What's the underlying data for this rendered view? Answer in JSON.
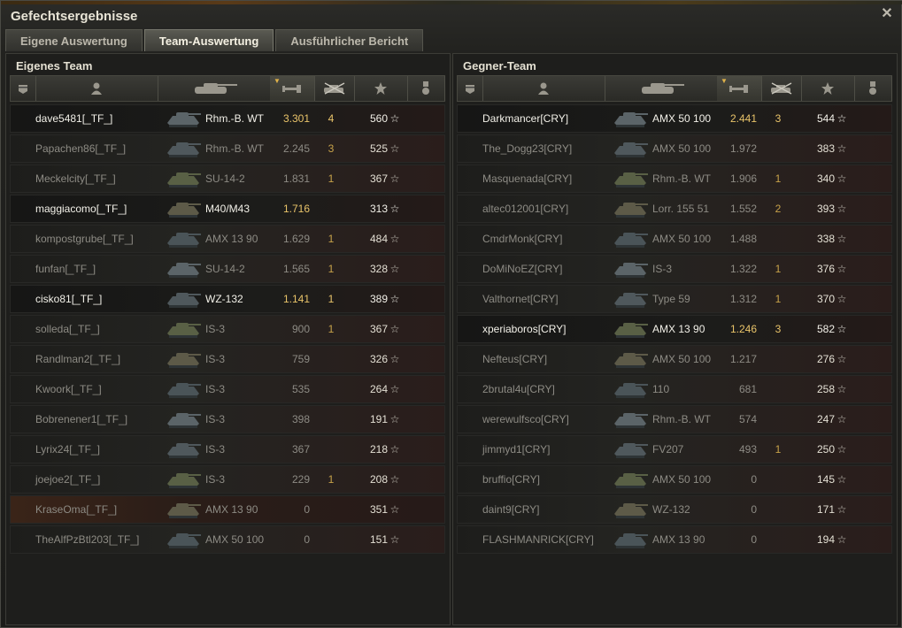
{
  "window": {
    "title": "Gefechtsergebnisse",
    "close_icon": "close-icon"
  },
  "tabs": [
    {
      "label": "Eigene Auswertung",
      "active": false
    },
    {
      "label": "Team-Auswertung",
      "active": true
    },
    {
      "label": "Ausführlicher Bericht",
      "active": false
    }
  ],
  "columns": [
    "platoon-icon",
    "player-icon",
    "tank-icon",
    "damage-icon",
    "kills-icon",
    "experience-star-icon",
    "medal-icon"
  ],
  "teams": {
    "own": {
      "title": "Eigenes Team",
      "rows": [
        {
          "name": "dave5481[_TF_]",
          "vehicle": "Rhm.-B. WT",
          "damage": "3.301",
          "kills": "4",
          "xp": "560",
          "alive": true
        },
        {
          "name": "Papachen86[_TF_]",
          "vehicle": "Rhm.-B. WT",
          "damage": "2.245",
          "kills": "3",
          "xp": "525",
          "alive": false
        },
        {
          "name": "Meckelcity[_TF_]",
          "vehicle": "SU-14-2",
          "damage": "1.831",
          "kills": "1",
          "xp": "367",
          "alive": false
        },
        {
          "name": "maggiacomo[_TF_]",
          "vehicle": "M40/M43",
          "damage": "1.716",
          "kills": "",
          "xp": "313",
          "alive": true
        },
        {
          "name": "kompostgrube[_TF_]",
          "vehicle": "AMX 13 90",
          "damage": "1.629",
          "kills": "1",
          "xp": "484",
          "alive": false
        },
        {
          "name": "funfan[_TF_]",
          "vehicle": "SU-14-2",
          "damage": "1.565",
          "kills": "1",
          "xp": "328",
          "alive": false
        },
        {
          "name": "cisko81[_TF_]",
          "vehicle": "WZ-132",
          "damage": "1.141",
          "kills": "1",
          "xp": "389",
          "alive": true
        },
        {
          "name": "solleda[_TF_]",
          "vehicle": "IS-3",
          "damage": "900",
          "kills": "1",
          "xp": "367",
          "alive": false
        },
        {
          "name": "Randlman2[_TF_]",
          "vehicle": "IS-3",
          "damage": "759",
          "kills": "",
          "xp": "326",
          "alive": false
        },
        {
          "name": "Kwoork[_TF_]",
          "vehicle": "IS-3",
          "damage": "535",
          "kills": "",
          "xp": "264",
          "alive": false
        },
        {
          "name": "Bobrenener1[_TF_]",
          "vehicle": "IS-3",
          "damage": "398",
          "kills": "",
          "xp": "191",
          "alive": false
        },
        {
          "name": "Lyrix24[_TF_]",
          "vehicle": "IS-3",
          "damage": "367",
          "kills": "",
          "xp": "218",
          "alive": false
        },
        {
          "name": "joejoe2[_TF_]",
          "vehicle": "IS-3",
          "damage": "229",
          "kills": "1",
          "xp": "208",
          "alive": false
        },
        {
          "name": "KraseOma[_TF_]",
          "vehicle": "AMX 13 90",
          "damage": "0",
          "kills": "",
          "xp": "351",
          "alive": false,
          "teamkill": true
        },
        {
          "name": "TheAlfPzBtl203[_TF_]",
          "vehicle": "AMX 50 100",
          "damage": "0",
          "kills": "",
          "xp": "151",
          "alive": false
        }
      ]
    },
    "enemy": {
      "title": "Gegner-Team",
      "rows": [
        {
          "name": "Darkmancer[CRY]",
          "vehicle": "AMX 50 100",
          "damage": "2.441",
          "kills": "3",
          "xp": "544",
          "alive": true
        },
        {
          "name": "The_Dogg23[CRY]",
          "vehicle": "AMX 50 100",
          "damage": "1.972",
          "kills": "",
          "xp": "383",
          "alive": false
        },
        {
          "name": "Masquenada[CRY]",
          "vehicle": "Rhm.-B. WT",
          "damage": "1.906",
          "kills": "1",
          "xp": "340",
          "alive": false
        },
        {
          "name": "altec012001[CRY]",
          "vehicle": "Lorr. 155 51",
          "damage": "1.552",
          "kills": "2",
          "xp": "393",
          "alive": false
        },
        {
          "name": "CmdrMonk[CRY]",
          "vehicle": "AMX 50 100",
          "damage": "1.488",
          "kills": "",
          "xp": "338",
          "alive": false
        },
        {
          "name": "DoMiNoEZ[CRY]",
          "vehicle": "IS-3",
          "damage": "1.322",
          "kills": "1",
          "xp": "376",
          "alive": false
        },
        {
          "name": "Valthornet[CRY]",
          "vehicle": "Type 59",
          "damage": "1.312",
          "kills": "1",
          "xp": "370",
          "alive": false
        },
        {
          "name": "xperiaboros[CRY]",
          "vehicle": "AMX 13 90",
          "damage": "1.246",
          "kills": "3",
          "xp": "582",
          "alive": true
        },
        {
          "name": "Nefteus[CRY]",
          "vehicle": "AMX 50 100",
          "damage": "1.217",
          "kills": "",
          "xp": "276",
          "alive": false
        },
        {
          "name": "2brutal4u[CRY]",
          "vehicle": "110",
          "damage": "681",
          "kills": "",
          "xp": "258",
          "alive": false
        },
        {
          "name": "werewulfsco[CRY]",
          "vehicle": "Rhm.-B. WT",
          "damage": "574",
          "kills": "",
          "xp": "247",
          "alive": false
        },
        {
          "name": "jimmyd1[CRY]",
          "vehicle": "FV207",
          "damage": "493",
          "kills": "1",
          "xp": "250",
          "alive": false
        },
        {
          "name": "bruffio[CRY]",
          "vehicle": "AMX 50 100",
          "damage": "0",
          "kills": "",
          "xp": "145",
          "alive": false
        },
        {
          "name": "daint9[CRY]",
          "vehicle": "WZ-132",
          "damage": "0",
          "kills": "",
          "xp": "171",
          "alive": false
        },
        {
          "name": "FLASHMANRICK[CRY]",
          "vehicle": "AMX 13 90",
          "damage": "0",
          "kills": "",
          "xp": "194",
          "alive": false
        }
      ]
    }
  },
  "colors": {
    "highlight_damage": "#e9c46a",
    "dead_text": "#8d8b84",
    "alive_text": "#f2f0e8",
    "sort_arrow": "#e0b24a"
  }
}
